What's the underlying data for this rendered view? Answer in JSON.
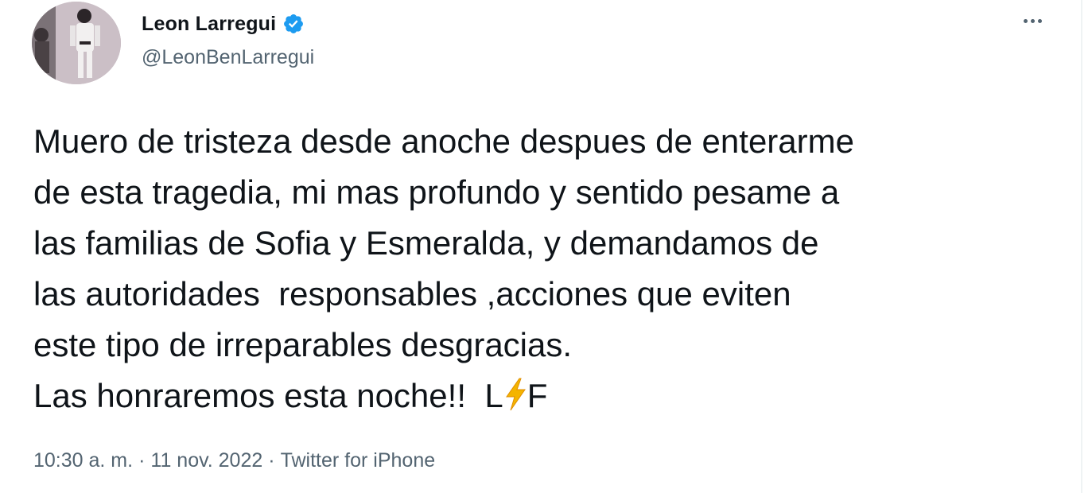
{
  "tweet": {
    "display_name": "Leon Larregui",
    "handle": "@LeonBenLarregui",
    "verified": true,
    "text_lines": [
      "Muero de tristeza desde anoche despues de enterarme",
      "de esta tragedia, mi mas profundo y sentido pesame a",
      "las familias de Sofia y Esmeralda, y demandamos de",
      "las autoridades  responsables ,acciones que eviten",
      "este tipo de irreparables desgracias."
    ],
    "last_line_before_emoji": "Las honraremos esta noche!!  L",
    "emoji": "high-voltage",
    "last_line_after_emoji": "F",
    "time": "10:30 a. m.",
    "separator": "·",
    "date": "11 nov. 2022",
    "source": "Twitter for iPhone"
  },
  "icons": {
    "more": "more-horizontal-icon",
    "verified": "verified-badge-icon"
  },
  "colors": {
    "text": "#0f1419",
    "secondary": "#536471",
    "verified_blue": "#1d9bf0",
    "bolt": "#f4b400"
  }
}
